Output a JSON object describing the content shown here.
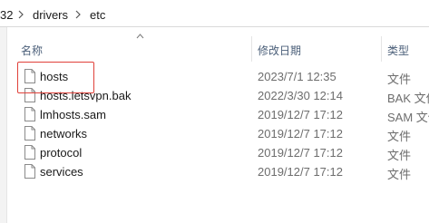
{
  "address_bar": {
    "segments": [
      "32",
      "drivers",
      "etc"
    ]
  },
  "columns": {
    "name": "名称",
    "date": "修改日期",
    "type": "类型"
  },
  "files": [
    {
      "name": "hosts",
      "date": "2023/7/1 12:35",
      "type": "文件",
      "icon": "file-icon"
    },
    {
      "name": "hosts.letsvpn.bak",
      "date": "2022/3/30 12:14",
      "type": "BAK 文件",
      "icon": "file-icon"
    },
    {
      "name": "lmhosts.sam",
      "date": "2019/12/7 17:12",
      "type": "SAM 文件",
      "icon": "file-icon"
    },
    {
      "name": "networks",
      "date": "2019/12/7 17:12",
      "type": "文件",
      "icon": "file-icon"
    },
    {
      "name": "protocol",
      "date": "2019/12/7 17:12",
      "type": "文件",
      "icon": "file-icon"
    },
    {
      "name": "services",
      "date": "2019/12/7 17:12",
      "type": "文件",
      "icon": "file-icon"
    }
  ],
  "colors": {
    "highlight_border": "#e0413a",
    "header_text": "#4c607a",
    "secondary_text": "#6d6d6d"
  }
}
